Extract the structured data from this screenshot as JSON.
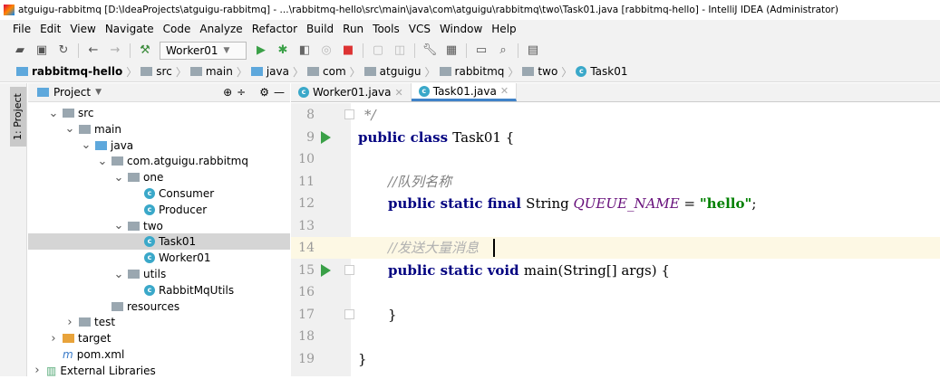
{
  "title": "atguigu-rabbitmq [D:\\IdeaProjects\\atguigu-rabbitmq] - ...\\rabbitmq-hello\\src\\main\\java\\com\\atguigu\\rabbitmq\\two\\Task01.java [rabbitmq-hello] - IntelliJ IDEA (Administrator)",
  "menu": [
    "File",
    "Edit",
    "View",
    "Navigate",
    "Code",
    "Analyze",
    "Refactor",
    "Build",
    "Run",
    "Tools",
    "VCS",
    "Window",
    "Help"
  ],
  "toolbar": {
    "run_config": "Worker01"
  },
  "breadcrumb": [
    "rabbitmq-hello",
    "src",
    "main",
    "java",
    "com",
    "atguigu",
    "rabbitmq",
    "two",
    "Task01"
  ],
  "side_strip": "1: Project",
  "project": {
    "title": "Project"
  },
  "tree": [
    {
      "label": "src",
      "depth": 1,
      "arrow": "v",
      "icon": "folder"
    },
    {
      "label": "main",
      "depth": 2,
      "arrow": "v",
      "icon": "folder"
    },
    {
      "label": "java",
      "depth": 3,
      "arrow": "v",
      "icon": "folder-blue"
    },
    {
      "label": "com.atguigu.rabbitmq",
      "depth": 4,
      "arrow": "v",
      "icon": "package"
    },
    {
      "label": "one",
      "depth": 5,
      "arrow": "v",
      "icon": "package"
    },
    {
      "label": "Consumer",
      "depth": 6,
      "arrow": "",
      "icon": "class"
    },
    {
      "label": "Producer",
      "depth": 6,
      "arrow": "",
      "icon": "class"
    },
    {
      "label": "two",
      "depth": 5,
      "arrow": "v",
      "icon": "package"
    },
    {
      "label": "Task01",
      "depth": 6,
      "arrow": "",
      "icon": "class",
      "selected": true
    },
    {
      "label": "Worker01",
      "depth": 6,
      "arrow": "",
      "icon": "class"
    },
    {
      "label": "utils",
      "depth": 5,
      "arrow": "v",
      "icon": "package"
    },
    {
      "label": "RabbitMqUtils",
      "depth": 6,
      "arrow": "",
      "icon": "class"
    },
    {
      "label": "resources",
      "depth": 4,
      "arrow": "",
      "icon": "folder"
    },
    {
      "label": "test",
      "depth": 2,
      "arrow": ">",
      "icon": "folder"
    },
    {
      "label": "target",
      "depth": 1,
      "arrow": ">",
      "icon": "folder-orange"
    },
    {
      "label": "pom.xml",
      "depth": 1,
      "arrow": "",
      "icon": "maven"
    },
    {
      "label": "External Libraries",
      "depth": 0,
      "arrow": ">",
      "icon": "libs"
    }
  ],
  "tabs": [
    {
      "label": "Worker01.java",
      "active": false
    },
    {
      "label": "Task01.java",
      "active": true
    }
  ],
  "code": {
    "l8": "*/",
    "l9a": "public class ",
    "l9b": "Task01 {",
    "l11": "//队列名称",
    "l12a": "public static final ",
    "l12b": "String ",
    "l12c": "QUEUE_NAME",
    "l12d": " = ",
    "l12e": "\"hello\"",
    "l12f": ";",
    "l14": "//发送大量消息",
    "l15a": "public static void ",
    "l15b": "main(String[] args) {",
    "l17": "}",
    "l19": "}"
  },
  "line_numbers": [
    "8",
    "9",
    "10",
    "11",
    "12",
    "13",
    "14",
    "15",
    "16",
    "17",
    "18",
    "19"
  ]
}
